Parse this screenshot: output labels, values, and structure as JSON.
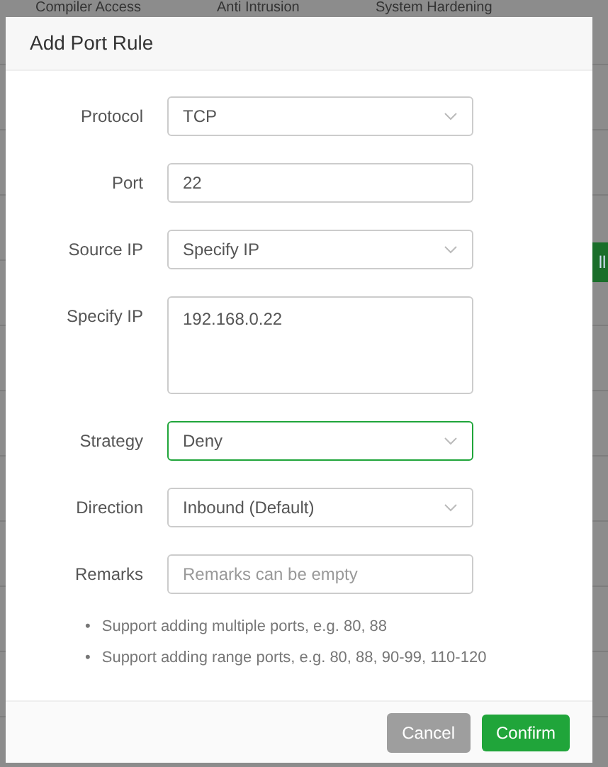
{
  "background": {
    "tabs": [
      "Compiler Access",
      "Anti Intrusion",
      "System Hardening"
    ],
    "button": "ll"
  },
  "dialog": {
    "title": "Add Port Rule",
    "fields": [
      {
        "kind": "select",
        "label": "Protocol",
        "value": "TCP",
        "focused": false
      },
      {
        "kind": "input",
        "label": "Port",
        "value": "22",
        "focused": false
      },
      {
        "kind": "select",
        "label": "Source IP",
        "value": "Specify IP",
        "focused": false
      },
      {
        "kind": "textarea",
        "label": "Specify IP",
        "value": "192.168.0.22",
        "focused": false
      },
      {
        "kind": "select",
        "label": "Strategy",
        "value": "Deny",
        "focused": true
      },
      {
        "kind": "select",
        "label": "Direction",
        "value": "Inbound (Default)",
        "focused": false
      },
      {
        "kind": "input",
        "label": "Remarks",
        "placeholder": "Remarks can be empty",
        "focused": false
      }
    ],
    "notes": [
      {
        "marker": "•",
        "text": "Support adding multiple ports, e.g. 80, 88"
      },
      {
        "marker": "•",
        "text": "Support adding range ports, e.g. 80, 88, 90-99, 110-120"
      }
    ],
    "buttons": [
      {
        "kind": "cancel",
        "label": "Cancel",
        "disabled": true
      },
      {
        "kind": "confirm",
        "label": "Confirm",
        "disabled": false
      }
    ]
  }
}
